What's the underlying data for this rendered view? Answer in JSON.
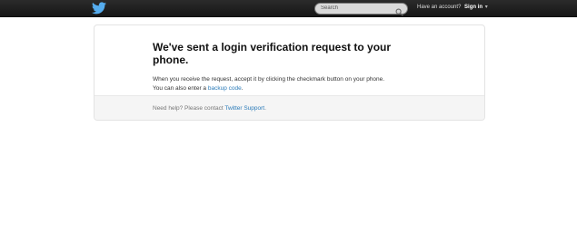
{
  "topbar": {
    "logo_icon": "twitter-bird-icon",
    "search": {
      "placeholder": "Search",
      "icon": "search-icon"
    },
    "account": {
      "prompt": "Have an account?",
      "signin_label": "Sign in",
      "caret": "▾"
    }
  },
  "main": {
    "heading": "We've sent a login verification request to your phone.",
    "description": {
      "line1": "When you receive the request, accept it by clicking the checkmark button on your phone.",
      "line2_prefix": "You can also enter a ",
      "backup_link": "backup code",
      "line2_suffix": "."
    },
    "footer": {
      "prefix": "Need help? Please contact ",
      "support_link": "Twitter Support",
      "suffix": "."
    }
  },
  "colors": {
    "topbar": "#1f1f1f",
    "link": "#2b7bb9",
    "logo": "#55acee",
    "footer_bg": "#f5f5f5"
  }
}
